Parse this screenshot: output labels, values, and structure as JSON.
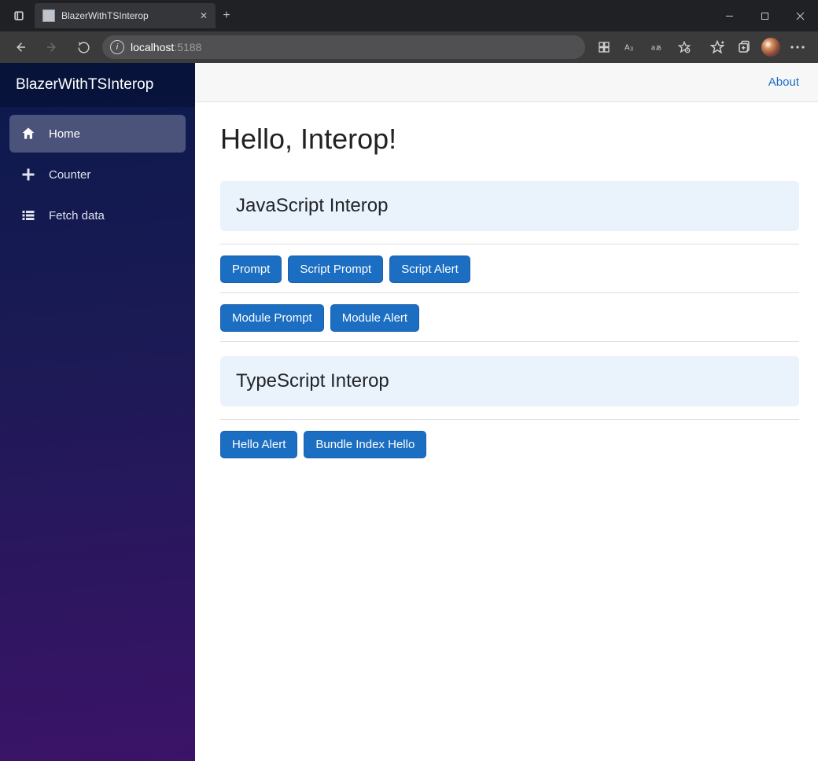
{
  "window": {
    "tab_title": "BlazerWithTSInterop",
    "address_host": "localhost",
    "address_port": ":5188"
  },
  "sidebar": {
    "brand": "BlazerWithTSInterop",
    "items": [
      {
        "label": "Home"
      },
      {
        "label": "Counter"
      },
      {
        "label": "Fetch data"
      }
    ]
  },
  "topbar": {
    "about": "About"
  },
  "page": {
    "title": "Hello, Interop!",
    "section_js": "JavaScript Interop",
    "section_ts": "TypeScript Interop",
    "buttons_row1": [
      {
        "label": "Prompt"
      },
      {
        "label": "Script Prompt"
      },
      {
        "label": "Script Alert"
      }
    ],
    "buttons_row2": [
      {
        "label": "Module Prompt"
      },
      {
        "label": "Module Alert"
      }
    ],
    "buttons_row3": [
      {
        "label": "Hello Alert"
      },
      {
        "label": "Bundle Index Hello"
      }
    ]
  },
  "colors": {
    "primary": "#1b6ec2",
    "alert_bg": "#eaf2fc"
  }
}
